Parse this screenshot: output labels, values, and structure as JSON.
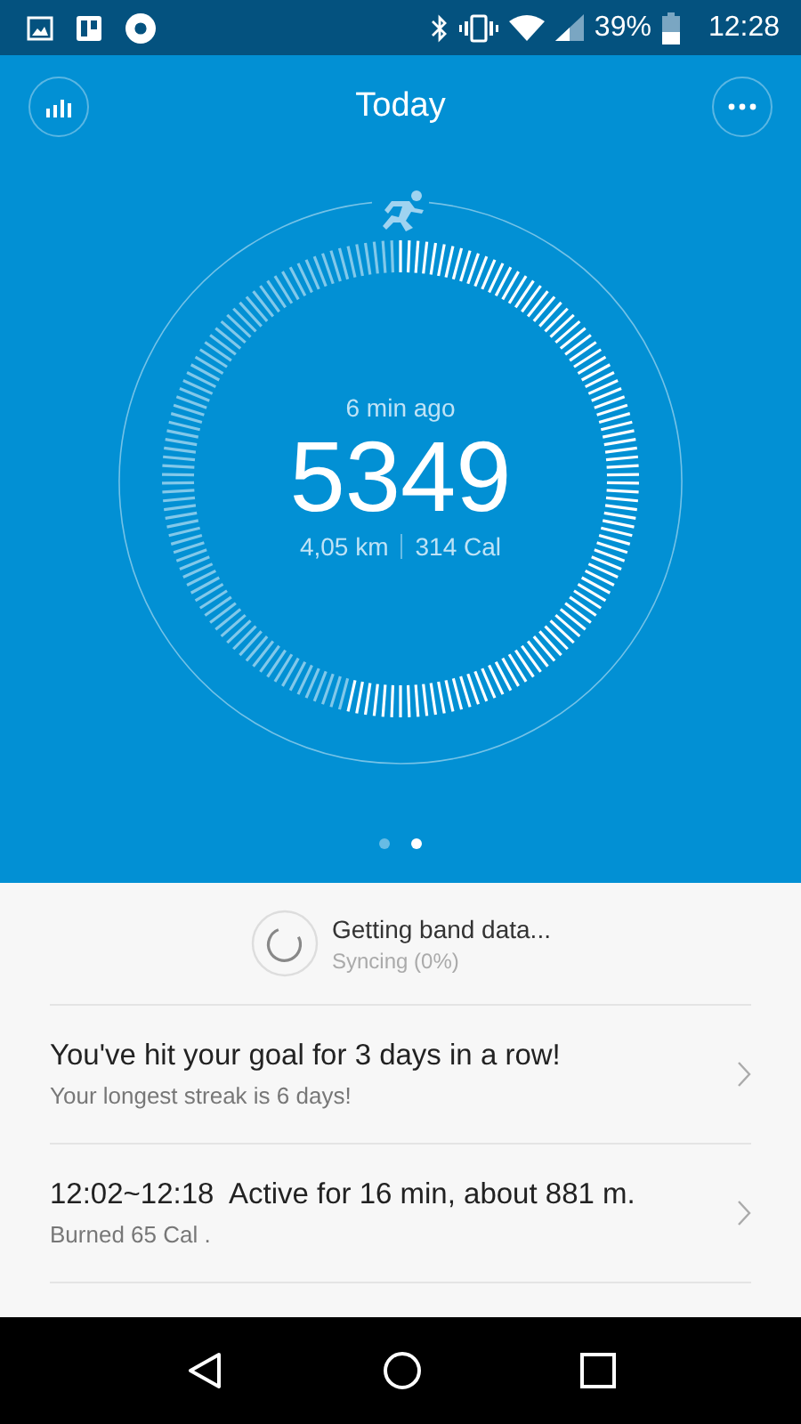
{
  "status_bar": {
    "battery": "39%",
    "time": "12:28"
  },
  "header": {
    "title": "Today"
  },
  "steps": {
    "updated": "6 min ago",
    "count": "5349",
    "distance": "4,05 km",
    "calories": "314 Cal"
  },
  "pager": [
    {
      "selected": false
    },
    {
      "selected": true
    }
  ],
  "sync": {
    "title": "Getting band data...",
    "subtitle": "Syncing (0%)"
  },
  "feed": [
    {
      "title": "You've hit your goal for 3 days in a row!",
      "subtitle": "Your longest streak is 6 days!"
    },
    {
      "title": "12:02~12:18  Active for 16 min, about 881 m.",
      "subtitle": "Burned 65 Cal ."
    }
  ]
}
